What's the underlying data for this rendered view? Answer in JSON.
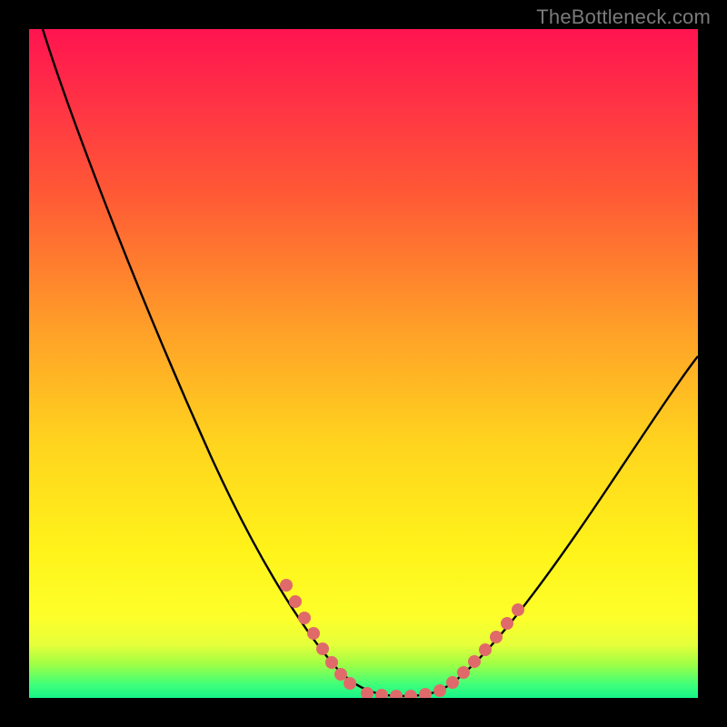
{
  "watermark": "TheBottleneck.com",
  "colors": {
    "background": "#000000",
    "curve": "#000000",
    "dot": "#e06a6a",
    "gradient_top": "#ff1450",
    "gradient_bottom": "#17f588"
  },
  "chart_data": {
    "type": "line",
    "title": "",
    "xlabel": "",
    "ylabel": "",
    "xlim": [
      0,
      100
    ],
    "ylim": [
      0,
      100
    ],
    "grid": false,
    "legend": false,
    "series": [
      {
        "name": "curve",
        "x": [
          2,
          5,
          10,
          15,
          20,
          25,
          30,
          35,
          40,
          42,
          45,
          48,
          50,
          52,
          55,
          58,
          60,
          62,
          65,
          70,
          75,
          80,
          85,
          90,
          95,
          100
        ],
        "y": [
          100,
          94,
          84,
          74,
          64,
          54,
          44,
          34,
          22,
          16,
          10,
          5,
          2,
          1,
          0,
          0,
          0,
          1,
          3,
          8,
          14,
          21,
          29,
          37,
          44,
          51
        ]
      }
    ],
    "annotations": {
      "highlight_dots": {
        "left_run": {
          "x_range": [
            40,
            49
          ],
          "count": 8
        },
        "flat_run": {
          "x_range": [
            51,
            60
          ],
          "count": 6
        },
        "right_run": {
          "x_range": [
            60,
            68
          ],
          "count": 7
        }
      }
    }
  }
}
